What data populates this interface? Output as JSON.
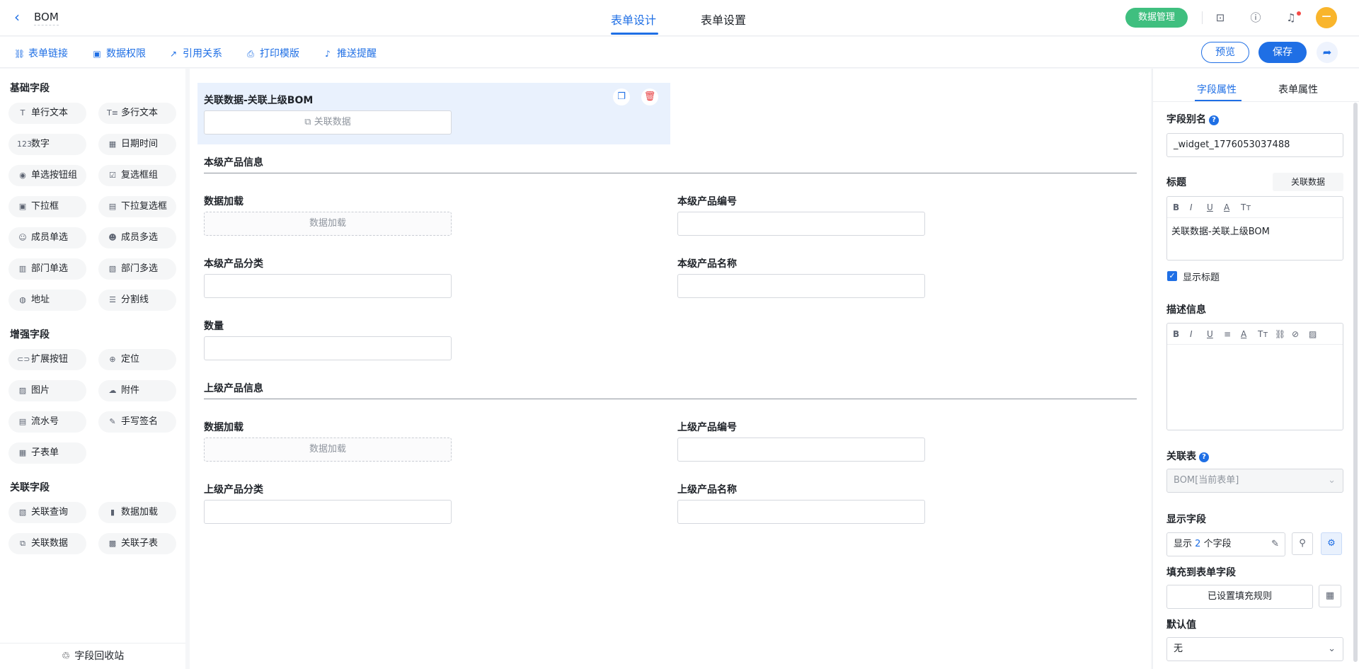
{
  "header": {
    "app_title": "BOM",
    "tabs": [
      {
        "label": "表单设计",
        "active": true
      },
      {
        "label": "表单设置",
        "active": false
      }
    ],
    "data_mgmt_label": "数据管理",
    "avatar_text": "—"
  },
  "toolbar": {
    "items": [
      {
        "label": "表单链接",
        "icon": "link-icon"
      },
      {
        "label": "数据权限",
        "icon": "data-permission-icon"
      },
      {
        "label": "引用关系",
        "icon": "reference-icon"
      },
      {
        "label": "打印模版",
        "icon": "printer-icon"
      },
      {
        "label": "推送提醒",
        "icon": "bell-icon"
      }
    ],
    "preview_label": "预览",
    "save_label": "保存"
  },
  "left_panel": {
    "groups": [
      {
        "title": "基础字段",
        "items": [
          {
            "label": "单行文本",
            "glyph": "T"
          },
          {
            "label": "多行文本",
            "glyph": "T≡"
          },
          {
            "label": "数字",
            "glyph": "123"
          },
          {
            "label": "日期时间",
            "glyph": "▦"
          },
          {
            "label": "单选按钮组",
            "glyph": "◉"
          },
          {
            "label": "复选框组",
            "glyph": "☑"
          },
          {
            "label": "下拉框",
            "glyph": "▣"
          },
          {
            "label": "下拉复选框",
            "glyph": "▤"
          },
          {
            "label": "成员单选",
            "glyph": "☺"
          },
          {
            "label": "成员多选",
            "glyph": "☻"
          },
          {
            "label": "部门单选",
            "glyph": "▥"
          },
          {
            "label": "部门多选",
            "glyph": "▧"
          },
          {
            "label": "地址",
            "glyph": "◍"
          },
          {
            "label": "分割线",
            "glyph": "☰"
          }
        ]
      },
      {
        "title": "增强字段",
        "items": [
          {
            "label": "扩展按钮",
            "glyph": "⊂⊃"
          },
          {
            "label": "定位",
            "glyph": "⊕"
          },
          {
            "label": "图片",
            "glyph": "▨"
          },
          {
            "label": "附件",
            "glyph": "☁"
          },
          {
            "label": "流水号",
            "glyph": "▤"
          },
          {
            "label": "手写签名",
            "glyph": "✎"
          },
          {
            "label": "子表单",
            "glyph": "▦"
          }
        ]
      },
      {
        "title": "关联字段",
        "items": [
          {
            "label": "关联查询",
            "glyph": "▧"
          },
          {
            "label": "数据加载",
            "glyph": "▮"
          },
          {
            "label": "关联数据",
            "glyph": "⧉"
          },
          {
            "label": "关联子表",
            "glyph": "▩"
          }
        ]
      }
    ],
    "recycle_label": "字段回收站"
  },
  "canvas": {
    "selected_field": {
      "label": "关联数据-关联上级BOM",
      "button_label": "关联数据"
    },
    "section1": {
      "title": "本级产品信息",
      "fields": [
        {
          "label": "数据加载",
          "type": "dashed",
          "text": "数据加载"
        },
        {
          "label": "本级产品编号",
          "type": "input",
          "text": ""
        },
        {
          "label": "本级产品分类",
          "type": "input",
          "text": ""
        },
        {
          "label": "本级产品名称",
          "type": "input",
          "text": ""
        },
        {
          "label": "数量",
          "type": "input",
          "text": ""
        }
      ]
    },
    "section2": {
      "title": "上级产品信息",
      "fields": [
        {
          "label": "数据加载",
          "type": "dashed",
          "text": "数据加载"
        },
        {
          "label": "上级产品编号",
          "type": "input",
          "text": ""
        },
        {
          "label": "上级产品分类",
          "type": "input",
          "text": ""
        },
        {
          "label": "上级产品名称",
          "type": "input",
          "text": ""
        }
      ]
    }
  },
  "right_panel": {
    "tabs": [
      {
        "label": "字段属性",
        "active": true
      },
      {
        "label": "表单属性",
        "active": false
      }
    ],
    "alias_label": "字段别名",
    "alias_value": "_widget_1776053037488",
    "title_label": "标题",
    "title_tag": "关联数据",
    "title_toolbar": [
      "B",
      "I",
      "U",
      "A",
      "Tт"
    ],
    "title_value": "关联数据-关联上级BOM",
    "show_title_label": "显示标题",
    "show_title_checked": true,
    "desc_label": "描述信息",
    "desc_toolbar": [
      "B",
      "I",
      "U",
      "≡",
      "A",
      "Tт",
      "⛓",
      "⊘",
      "▨"
    ],
    "related_table_label": "关联表",
    "related_table_value": "BOM[当前表单]",
    "display_fields_label": "显示字段",
    "display_fields_prefix": "显示",
    "display_fields_count": "2",
    "display_fields_suffix": "个字段",
    "fill_label": "填充到表单字段",
    "fill_button": "已设置填充规则",
    "default_label": "默认值",
    "default_value": "无"
  },
  "colors": {
    "accent": "#1f6fe5",
    "data_mgmt_green": "#3fbf7f",
    "avatar_orange": "#f9b52c",
    "selected_bg": "#e9f1fd",
    "delete_red": "#e6393c"
  }
}
